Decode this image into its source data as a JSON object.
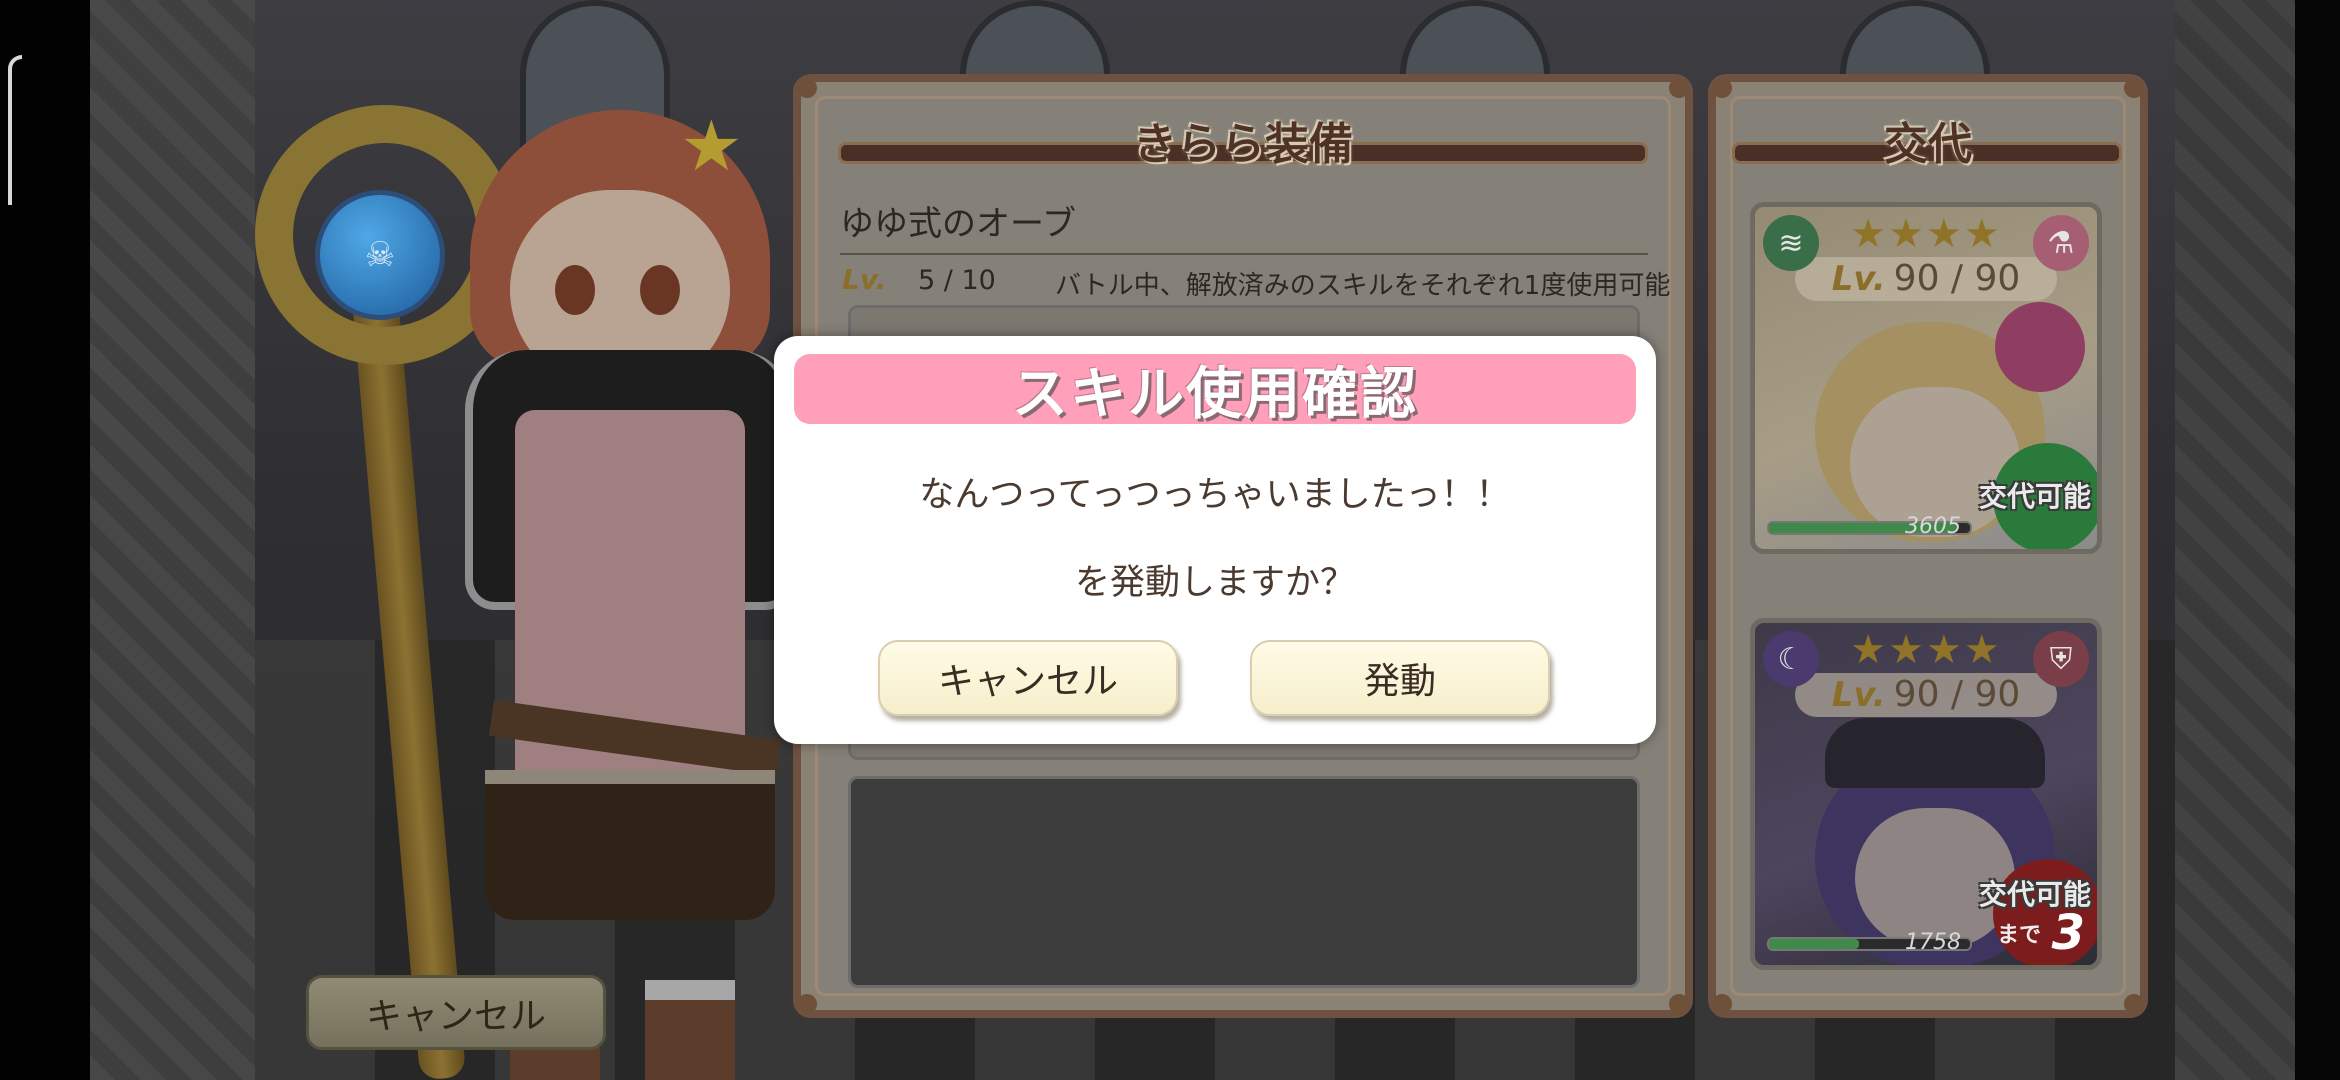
{
  "game": {
    "cancel_button_label": "キャンセル",
    "equipment_panel": {
      "title": "きらら装備",
      "item_name": "ゆゆ式のオーブ",
      "level_label": "Lv.",
      "level_value": "5 / 10",
      "description": "バトル中、解放済みのスキルをそれぞれ1度使用可能"
    },
    "swap_panel": {
      "title": "交代",
      "cards": [
        {
          "stars": "★★★★",
          "level_label": "Lv.",
          "level_value": "90 / 90",
          "element_icon": "wind-icon",
          "class_icon": "potion-icon",
          "hp": "3605",
          "hp_fraction": 0.93,
          "status": "交代可能"
        },
        {
          "stars": "★★★★",
          "level_label": "Lv.",
          "level_value": "90 / 90",
          "element_icon": "moon-icon",
          "class_icon": "shield-icon",
          "hp": "1758",
          "hp_fraction": 0.45,
          "status": "交代可能",
          "status_sub": "まで",
          "status_count": "3"
        }
      ]
    }
  },
  "dialog": {
    "title": "スキル使用確認",
    "skill_name": "なんつってっつっちゃいましたっ！！",
    "question": "を発動しますか？",
    "cancel_label": "キャンセル",
    "activate_label": "発動",
    "header_color": "#ff9fba"
  }
}
